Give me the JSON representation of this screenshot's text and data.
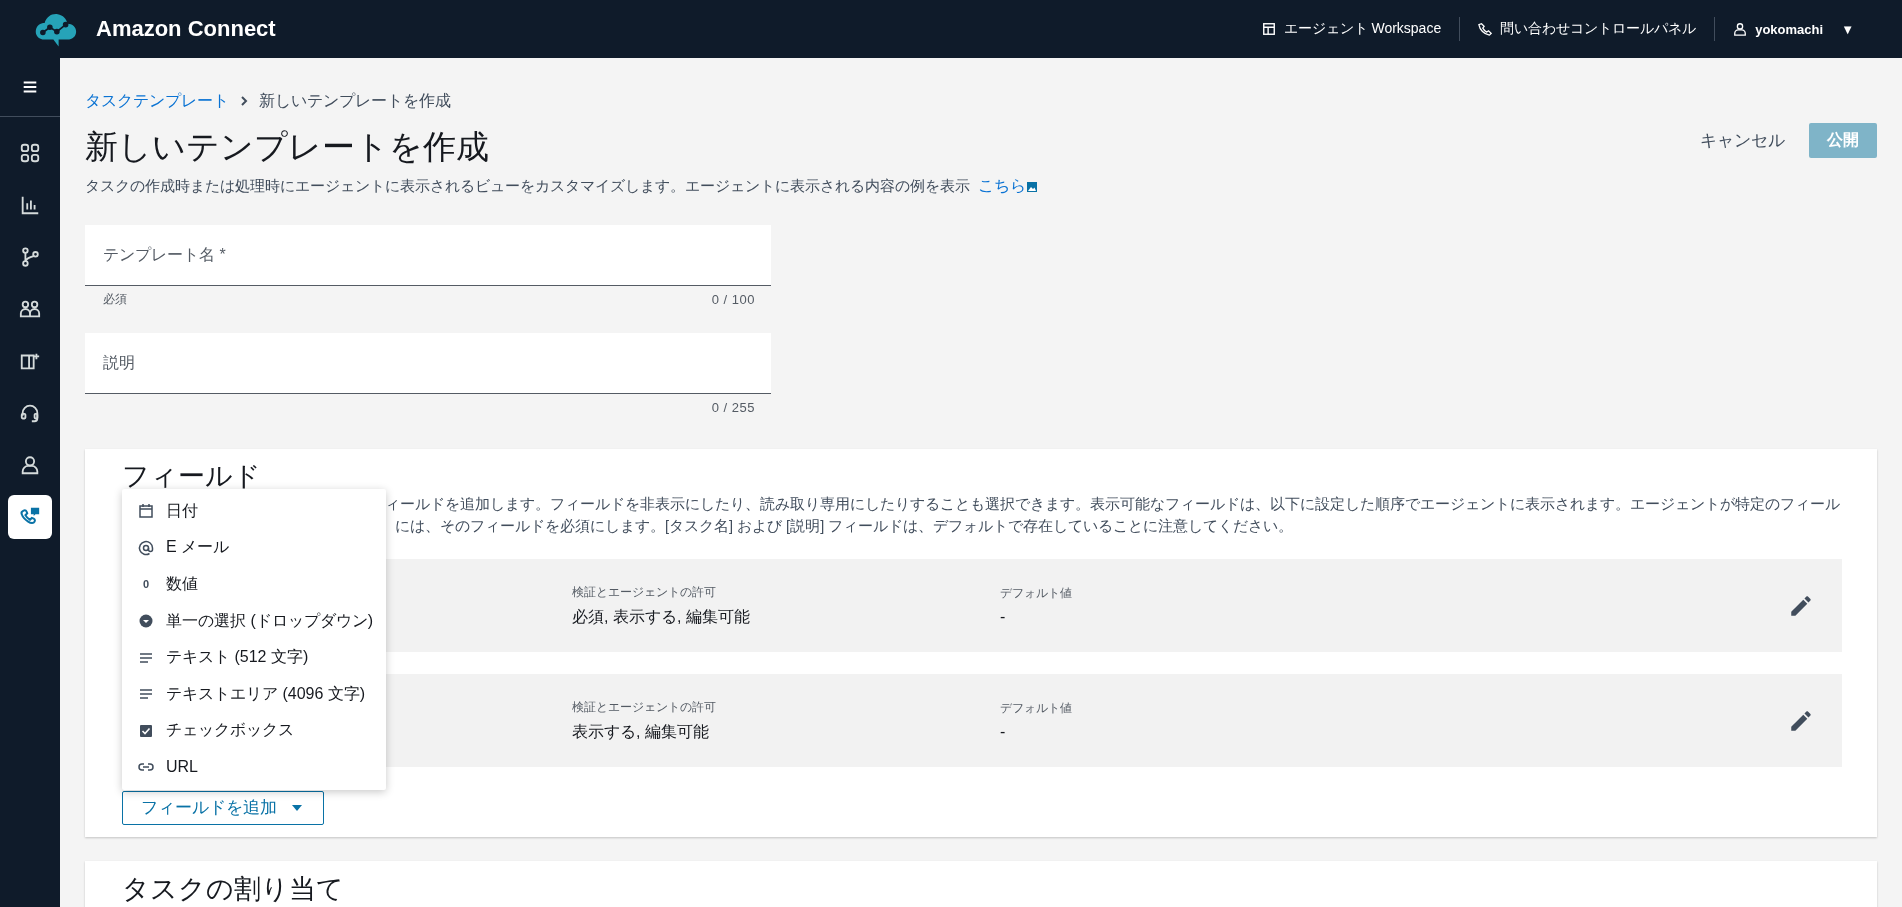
{
  "top_bar": {
    "product": "Amazon Connect",
    "links": [
      {
        "label": "エージェント Workspace",
        "kind": "workspace"
      },
      {
        "label": "問い合わせコントロールパネル",
        "kind": "phone"
      }
    ],
    "user": {
      "name": "yokomachi",
      "caret": "▼"
    }
  },
  "sidebar": {
    "items": [
      {
        "kind": "dashboard",
        "selected": false
      },
      {
        "kind": "analytics",
        "selected": false
      },
      {
        "kind": "routing",
        "selected": false
      },
      {
        "kind": "users",
        "selected": false
      },
      {
        "kind": "knowledge",
        "selected": false
      },
      {
        "kind": "headset",
        "selected": false
      },
      {
        "kind": "person",
        "selected": false
      },
      {
        "kind": "tasks",
        "selected": true
      }
    ]
  },
  "breadcrumb": [
    {
      "label": "タスクテンプレート",
      "kind": "link"
    },
    {
      "label": "新しいテンプレートを作成",
      "kind": "current"
    }
  ],
  "page": {
    "title": "新しいテンプレートを作成",
    "description": "タスクの作成時または処理時にエージェントに表示されるビューをカスタマイズします。エージェントに表示される内容の例を表示",
    "link": "こちら"
  },
  "actions": [
    {
      "label": "キャンセル",
      "kind": "text",
      "disabled": false
    },
    {
      "label": "公開",
      "kind": "primary",
      "disabled": true
    }
  ],
  "form_fields": [
    {
      "placeholder": "テンプレート名 *",
      "helper": "必須",
      "counter": "0 / 100"
    },
    {
      "placeholder": "説明",
      "counter": "0 / 255"
    }
  ],
  "fields_section": {
    "title": "フィールド",
    "description_lines": [
      "ィールドを追加します。フィールドを非表示にしたり、読み取り専用にしたりすることも選択できます。表示可能なフィールドは、以下に設定した順序でエージェントに表示されます。エージェントが特定のフィール",
      "には、そのフィールドを必須にします。[タスク名] および [説明] フィールドは、デフォルトで存在していることに注意してください。"
    ],
    "rows": [
      {
        "permissions_label": "検証とエージェントの許可",
        "permissions": "必須, 表示する, 編集可能",
        "default_label": "デフォルト値",
        "default": "-"
      },
      {
        "permissions_label": "検証とエージェントの許可",
        "permissions": "表示する, 編集可能",
        "default_label": "デフォルト値",
        "default": "-"
      }
    ],
    "add_button": {
      "label": "フィールドを追加",
      "expanded": true
    },
    "menu_items": [
      {
        "label": "日付",
        "kind": "date"
      },
      {
        "label": "E メール",
        "kind": "email"
      },
      {
        "label": "数値",
        "kind": "number",
        "icon": "0"
      },
      {
        "label": "単一の選択 (ドロップダウン)",
        "kind": "select"
      },
      {
        "label": "テキスト (512 文字)",
        "kind": "text"
      },
      {
        "label": "テキストエリア (4096 文字)",
        "kind": "text"
      },
      {
        "label": "チェックボックス",
        "kind": "checkbox"
      },
      {
        "label": "URL",
        "kind": "url"
      }
    ]
  },
  "next_section": {
    "title": "タスクの割り当て"
  }
}
